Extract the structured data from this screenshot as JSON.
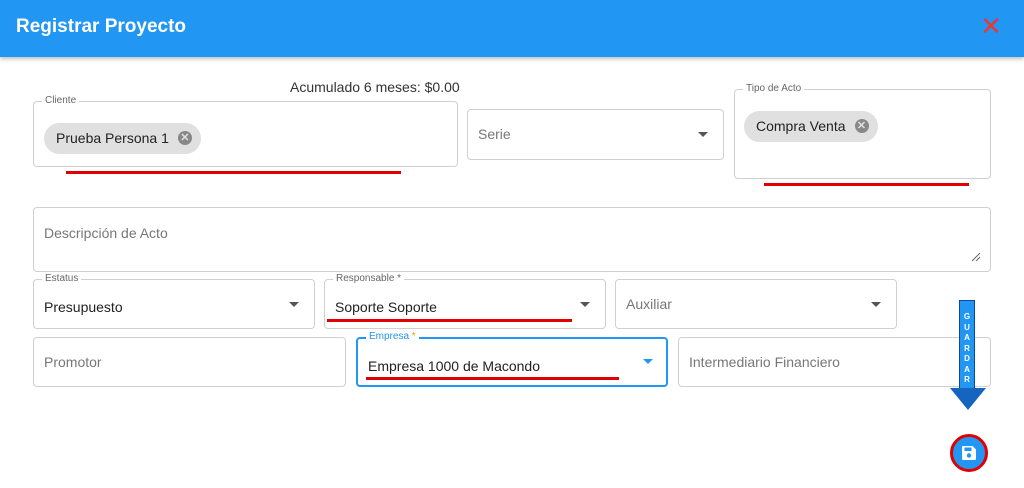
{
  "header": {
    "title": "Registrar Proyecto",
    "close_icon": "close-icon"
  },
  "summary": {
    "accumulated": "Acumulado 6 meses: $0.00"
  },
  "form": {
    "cliente": {
      "label": "Cliente",
      "chip": "Prueba Persona 1"
    },
    "serie": {
      "placeholder": "Serie"
    },
    "tipo_acto": {
      "label": "Tipo de Acto",
      "chip": "Compra Venta"
    },
    "descripcion": {
      "placeholder": "Descripción de Acto"
    },
    "estatus": {
      "label": "Estatus",
      "value": "Presupuesto"
    },
    "responsable": {
      "label": "Responsable",
      "required_mark": "*",
      "value": "Soporte Soporte"
    },
    "auxiliar": {
      "placeholder": "Auxiliar"
    },
    "promotor": {
      "placeholder": "Promotor"
    },
    "empresa": {
      "label": "Empresa",
      "required_mark": "*",
      "value": "Empresa 1000 de Macondo"
    },
    "intermediario": {
      "placeholder": "Intermediario Financiero"
    }
  },
  "annotation": {
    "arrow_text": "GUARDAR",
    "highlight_color": "#e00000",
    "arrow_color": "#2196f3"
  },
  "actions": {
    "save_icon": "floppy-disk-icon"
  },
  "colors": {
    "header": "#2196f3",
    "close": "#e53935",
    "chip": "#e0e0e0"
  }
}
